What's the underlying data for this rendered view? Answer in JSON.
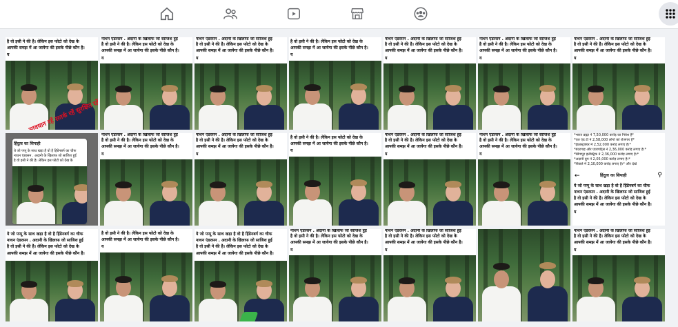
{
  "nav": {
    "items": [
      "home-icon",
      "friends-icon",
      "watch-icon",
      "marketplace-icon",
      "groups-icon"
    ],
    "active": "none",
    "menu_icon": "menu-grid-icon"
  },
  "caption": {
    "a1": "है वो इसी ने की है। लेकिन इस फोटो को देख के",
    "a2": "आपकी समझ में आ जायेगा की इसके पीछे कौन है।",
    "b1": "नाथन एंडरसन . अदानी के खिलाफ जो साजिश हुई",
    "b2": "है वो इसी ने की है। लेकिन इस फोटो को देख के",
    "b3": "आपकी समझ में आ जायेगा की इसके पीछे कौन है।",
    "c1": "ये जो पप्पू के साथ खड़ा है वो है हिंडेनबर्ग का चीफ",
    "c2": "नाथन एंडरसन . अदानी के खिलाफ जो साजिश हुई",
    "yo": "य"
  },
  "watermark": "सावधान रहें सतर्क रहें सुरक्षित रहें",
  "phone_title": "हिंदुत्व का सिपाही",
  "stats": {
    "l1": "*भारत ब्रह्मा ने 7,50,000 करोड़ का निवेश है*",
    "l2": "*एल एंड टी ने 2,58,000 लोगों को रोजगार है*",
    "l3": "*इंफ्रास्ट्रक्चर में 2,52,000 करोड़ लगाए हैं।*",
    "l4": "*बंदरगाह और एयरपोर्ट्स ने 2,36,000 करोड़ लगाए हैं।*",
    "l5": "*सिंगापुर इलेक्ट्रिक ने 2,36,000 करोड़ लगाए हैं।*",
    "l6": "*अदानी ग्रुप ने 2,05,000 करोड़ लगाए हैं।*",
    "l7": "*पिछले में 2,10,000 करोड़ लगाए हैं।*  और देखें"
  },
  "tiles": [
    {
      "variant": "a",
      "mark": true
    },
    {
      "variant": "b"
    },
    {
      "variant": "b"
    },
    {
      "variant": "a"
    },
    {
      "variant": "b"
    },
    {
      "variant": "b"
    },
    {
      "variant": "b"
    },
    {
      "variant": "phone"
    },
    {
      "variant": "b"
    },
    {
      "variant": "b"
    },
    {
      "variant": "a"
    },
    {
      "variant": "b"
    },
    {
      "variant": "b"
    },
    {
      "variant": "stats"
    },
    {
      "variant": "c"
    },
    {
      "variant": "a"
    },
    {
      "variant": "c"
    },
    {
      "variant": "b"
    },
    {
      "variant": "b"
    },
    {
      "variant": "photo"
    },
    {
      "variant": "b"
    }
  ]
}
